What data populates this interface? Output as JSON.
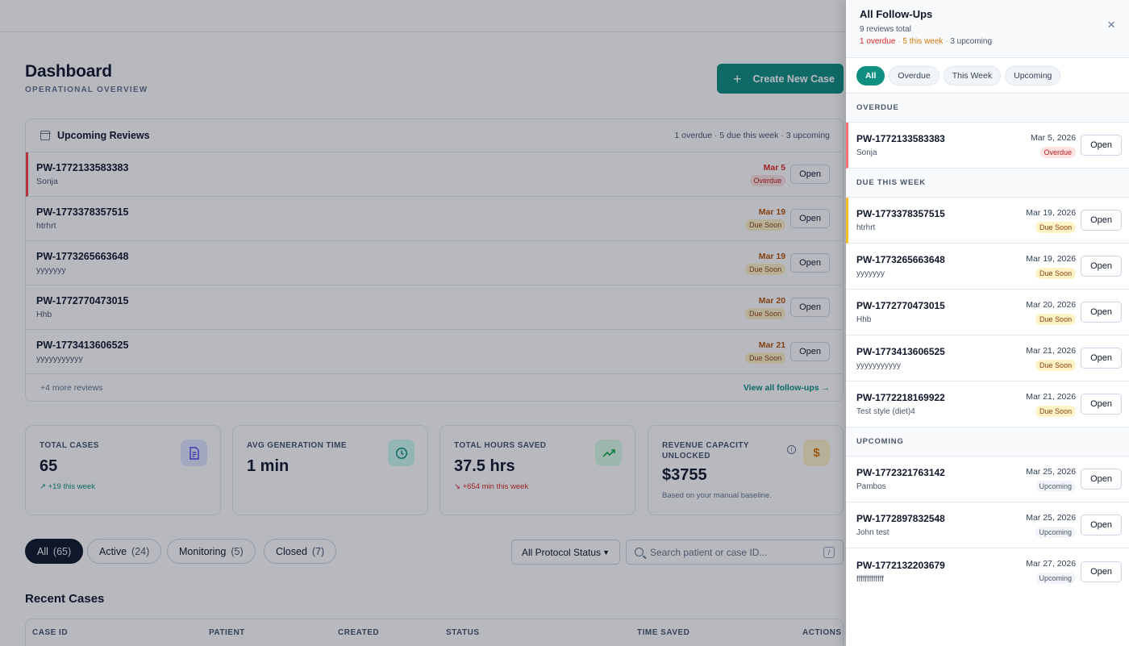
{
  "dashboard": {
    "title": "Dashboard",
    "subtitle": "OPERATIONAL OVERVIEW",
    "create_label": "Create New Case"
  },
  "reviews": {
    "title": "Upcoming Reviews",
    "summary": "1 overdue · 5 due this week · 3 upcoming",
    "items": [
      {
        "id": "PW-1772133583383",
        "name": "Sonja",
        "date": "Mar 5",
        "badge": "Overdue"
      },
      {
        "id": "PW-1773378357515",
        "name": "htrhrt",
        "date": "Mar 19",
        "badge": "Due Soon"
      },
      {
        "id": "PW-1773265663648",
        "name": "yyyyyyy",
        "date": "Mar 19",
        "badge": "Due Soon"
      },
      {
        "id": "PW-1772770473015",
        "name": "Hhb",
        "date": "Mar 20",
        "badge": "Due Soon"
      },
      {
        "id": "PW-1773413606525",
        "name": "yyyyyyyyyyy",
        "date": "Mar 21",
        "badge": "Due Soon"
      }
    ],
    "open_label": "Open",
    "more": "+4 more reviews",
    "view_all": "View all follow-ups →"
  },
  "stats": [
    {
      "label": "TOTAL CASES",
      "value": "65",
      "sub": "+19 this week",
      "icon": "document-icon"
    },
    {
      "label": "AVG GENERATION TIME",
      "value": "1 min",
      "sub": "",
      "icon": "clock-icon"
    },
    {
      "label": "TOTAL HOURS SAVED",
      "value": "37.5 hrs",
      "sub": "+654 min this week",
      "icon": "trend-up-icon"
    },
    {
      "label": "REVENUE CAPACITY UNLOCKED",
      "value": "$3755",
      "sub": "Based on your manual baseline.",
      "icon": "dollar-icon",
      "icon_glyph": "$"
    }
  ],
  "filters": [
    {
      "label": "All",
      "count": "(65)"
    },
    {
      "label": "Active",
      "count": "(24)"
    },
    {
      "label": "Monitoring",
      "count": "(5)"
    },
    {
      "label": "Closed",
      "count": "(7)"
    }
  ],
  "protocol_select": "All Protocol Status",
  "search": {
    "placeholder": "Search patient or case ID...",
    "kbd": "/"
  },
  "recent": {
    "title": "Recent Cases",
    "columns": [
      "CASE ID",
      "PATIENT",
      "CREATED",
      "STATUS",
      "TIME SAVED",
      "ACTIONS"
    ]
  },
  "drawer": {
    "title": "All Follow-Ups",
    "total": "9 reviews total",
    "counts": {
      "overdue": "1 overdue",
      "week": "5 this week",
      "upcoming": "3 upcoming",
      "sep": "·"
    },
    "close_glyph": "×",
    "tabs": [
      "All",
      "Overdue",
      "This Week",
      "Upcoming"
    ],
    "open_label": "Open",
    "sections": [
      {
        "title": "OVERDUE",
        "items": [
          {
            "id": "PW-1772133583383",
            "name": "Sonja",
            "date": "Mar 5, 2026",
            "badge": "Overdue"
          }
        ]
      },
      {
        "title": "DUE THIS WEEK",
        "items": [
          {
            "id": "PW-1773378357515",
            "name": "htrhrt",
            "date": "Mar 19, 2026",
            "badge": "Due Soon"
          },
          {
            "id": "PW-1773265663648",
            "name": "yyyyyyy",
            "date": "Mar 19, 2026",
            "badge": "Due Soon"
          },
          {
            "id": "PW-1772770473015",
            "name": "Hhb",
            "date": "Mar 20, 2026",
            "badge": "Due Soon"
          },
          {
            "id": "PW-1773413606525",
            "name": "yyyyyyyyyyy",
            "date": "Mar 21, 2026",
            "badge": "Due Soon"
          },
          {
            "id": "PW-1772218169922",
            "name": "Test style (diet)4",
            "date": "Mar 21, 2026",
            "badge": "Due Soon"
          }
        ]
      },
      {
        "title": "UPCOMING",
        "items": [
          {
            "id": "PW-1772321763142",
            "name": "Pambos",
            "date": "Mar 25, 2026",
            "badge": "Upcoming"
          },
          {
            "id": "PW-1772897832548",
            "name": "John test",
            "date": "Mar 25, 2026",
            "badge": "Upcoming"
          },
          {
            "id": "PW-1772132203679",
            "name": "fffffffffffff",
            "date": "Mar 27, 2026",
            "badge": "Upcoming"
          }
        ]
      }
    ]
  },
  "colors": {
    "accent": "#0f8f80",
    "overdue": "#dc2626",
    "due_soon": "#b45309",
    "dark": "#0f172a"
  }
}
